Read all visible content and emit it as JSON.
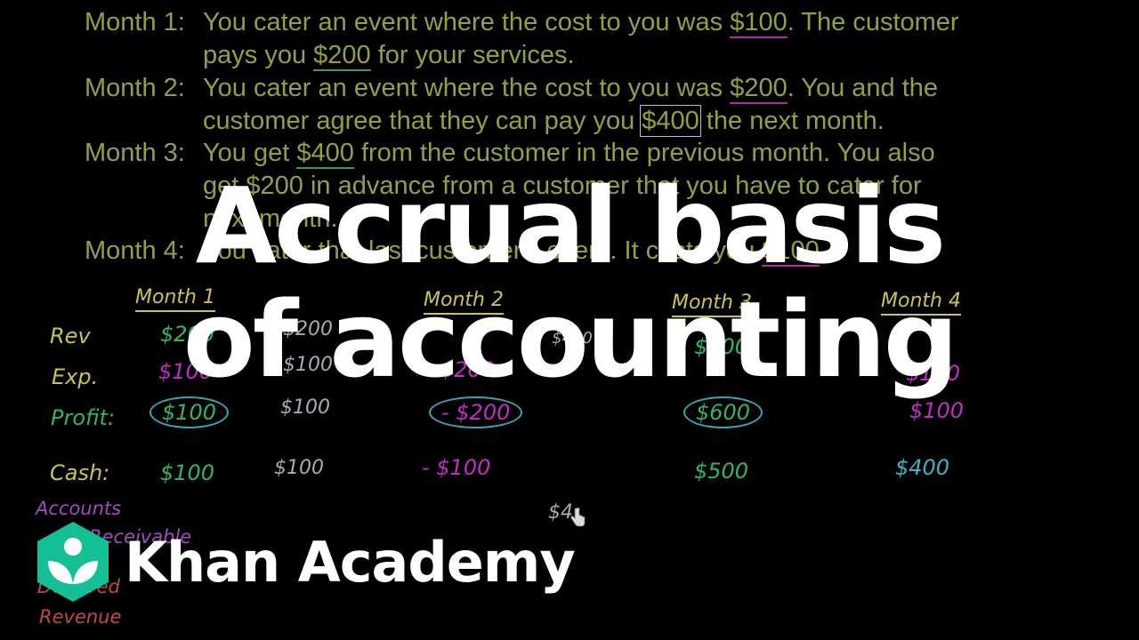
{
  "video": {
    "title_overlay": {
      "line1": "Accrual basis",
      "line2": "of accounting"
    },
    "brand": {
      "name": "Khan Academy",
      "logo_color": "#14bf96"
    },
    "problem": [
      {
        "label": "Month 1:",
        "lines": [
          [
            "You cater an event where the cost to you was ",
            "$100",
            ".  The customer"
          ],
          [
            "pays you ",
            "$200",
            " for your services."
          ]
        ]
      },
      {
        "label": "Month 2:",
        "lines": [
          [
            "You cater an event where the cost to you was ",
            "$200",
            ".  You and the"
          ],
          [
            "customer agree that they can pay you ",
            "$400",
            " the next month."
          ]
        ]
      },
      {
        "label": "Month 3:",
        "lines": [
          [
            "You get ",
            "$400",
            " from the customer in the previous month.  You also"
          ],
          [
            "get $200 in advance from a customer that you have to cater for"
          ],
          [
            "next month."
          ]
        ]
      },
      {
        "label": "Month 4:",
        "lines": [
          [
            "You cater that last customer's event.  It costs you ",
            "$100",
            ""
          ]
        ]
      }
    ],
    "table": {
      "headers": [
        "Month 1",
        "Month 2",
        "Month 3",
        "Month 4"
      ],
      "row_labels": [
        "Rev",
        "Exp.",
        "Profit:",
        "Cash:",
        "Accounts",
        "Receivable",
        "Deferred",
        "Revenue"
      ],
      "month1": {
        "rev": "$200",
        "exp": "$100",
        "profit": "$100",
        "cash": "$100"
      },
      "month1_alt": {
        "rev": "$200",
        "exp": "$100",
        "profit": "$100",
        "cash": "$100"
      },
      "month2": {
        "rev_note": "$400",
        "exp": "$200",
        "profit": "- $200",
        "cash": "- $100"
      },
      "month3": {
        "rev": "$600",
        "profit": "$600",
        "cash": "$500"
      },
      "month4": {
        "exp": "$100",
        "profit": "$100",
        "cash": "$400"
      },
      "accounts_receivable_partial": "$4"
    },
    "colors": {
      "text_green": "#8fa23f",
      "hw_yellow": "#c9c44c",
      "hw_green": "#2fb56a",
      "hw_pink": "#c12ec2",
      "hw_teal": "#3bb3c2"
    }
  }
}
